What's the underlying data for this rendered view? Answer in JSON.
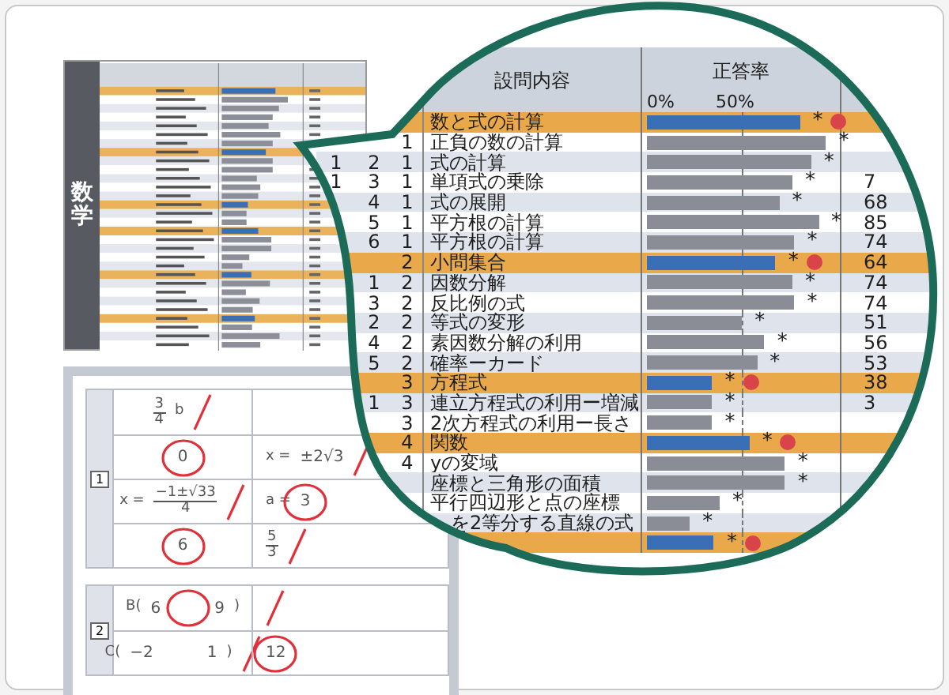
{
  "report": {
    "subject": "数学"
  },
  "answer_sheet": {
    "sections": [
      {
        "number": "1",
        "rows": [
          [
            {
              "fraction": {
                "num": "3",
                "den": "4"
              },
              "suffix": "b",
              "correct": false
            }
          ],
          [
            {
              "values": [
                "0"
              ],
              "correct": true
            },
            {
              "prefix": "x =",
              "values": [
                "±2√3"
              ],
              "correct": false
            }
          ],
          [
            {
              "prefix": "x =",
              "fraction": {
                "num": "−1±√33",
                "den": "4"
              },
              "correct": false
            },
            {
              "prefix": "a =",
              "values": [
                "3"
              ],
              "correct": true
            }
          ],
          [
            {
              "values": [
                "6"
              ],
              "correct": true
            },
            {
              "fraction": {
                "num": "5",
                "den": "3"
              },
              "correct": false
            }
          ]
        ]
      },
      {
        "number": "2",
        "rows": [
          [
            {
              "prefix": "B(",
              "values": [
                "6",
                "9"
              ],
              "suffix": ")",
              "correct": true
            },
            {
              "correct": false
            }
          ],
          [
            {
              "prefix": "C(",
              "values": [
                "−2",
                "1"
              ],
              "suffix": ")",
              "correct": false
            },
            {
              "values": [
                "12"
              ],
              "correct": true
            }
          ]
        ]
      }
    ]
  },
  "lens_table": {
    "header": {
      "content": "設問内容",
      "rate": "正答率",
      "tick_0": "0%",
      "tick_50": "50%"
    },
    "rows": [
      {
        "kind": "summary",
        "label": "数と式の計算",
        "level": 0.82,
        "mark": "*",
        "flag": true
      },
      {
        "kind": "item",
        "c3": "1",
        "label": "正負の数の計算",
        "level": 0.96,
        "mark": "*"
      },
      {
        "kind": "item",
        "c1": "1",
        "c2": "2",
        "c3": "1",
        "label": "式の計算",
        "level": 0.88,
        "mark": "*"
      },
      {
        "kind": "item",
        "c1": "1",
        "c2": "3",
        "c3": "1",
        "label": "単項式の乗除",
        "level": 0.78,
        "mark": "*",
        "value": "7"
      },
      {
        "kind": "item",
        "c2": "4",
        "c3": "1",
        "label": "式の展開",
        "level": 0.71,
        "mark": "*",
        "value": "68"
      },
      {
        "kind": "item",
        "c2": "5",
        "c3": "1",
        "label": "平方根の計算",
        "level": 0.92,
        "mark": "*",
        "value": "85"
      },
      {
        "kind": "item",
        "c2": "6",
        "c3": "1",
        "label": "平方根の計算",
        "level": 0.79,
        "mark": "*",
        "value": "74"
      },
      {
        "kind": "summary",
        "c3": "2",
        "label": "小問集合",
        "level": 0.69,
        "mark": "*",
        "flag": true,
        "value": "64"
      },
      {
        "kind": "item",
        "c2": "1",
        "c3": "2",
        "label": "因数分解",
        "level": 0.78,
        "mark": "*",
        "value": "74"
      },
      {
        "kind": "item",
        "c2": "3",
        "c3": "2",
        "label": "反比例の式",
        "level": 0.79,
        "mark": "*",
        "value": "74"
      },
      {
        "kind": "item",
        "c2": "2",
        "c3": "2",
        "label": "等式の変形",
        "level": 0.51,
        "mark": "*",
        "value": "51"
      },
      {
        "kind": "item",
        "c2": "4",
        "c3": "2",
        "label": "素因数分解の利用",
        "level": 0.63,
        "mark": "*",
        "value": "56"
      },
      {
        "kind": "item",
        "c2": "5",
        "c3": "2",
        "label": "確率ーカード",
        "level": 0.59,
        "mark": "*",
        "value": "53"
      },
      {
        "kind": "summary",
        "c3": "3",
        "label": "方程式",
        "level": 0.35,
        "mark": "*",
        "flag": true,
        "value": "38"
      },
      {
        "kind": "item",
        "c2": "1",
        "c3": "3",
        "label": "連立方程式の利用ー増減",
        "level": 0.35,
        "mark": "*",
        "value": "3"
      },
      {
        "kind": "item",
        "c3": "3",
        "label": "2次方程式の利用ー長さ",
        "level": 0.35,
        "mark": "*"
      },
      {
        "kind": "summary",
        "c3": "4",
        "label": "関数",
        "level": 0.55,
        "mark": "*",
        "flag": true
      },
      {
        "kind": "item",
        "c3": "4",
        "label": "yの変域",
        "level": 0.74,
        "mark": "*"
      },
      {
        "kind": "item",
        "label": "座標と三角形の面積",
        "level": 0.74,
        "mark": "*"
      },
      {
        "kind": "item",
        "label": "平行四辺形と点の座標",
        "level": 0.39,
        "mark": "*"
      },
      {
        "kind": "cut",
        "label": "を2等分する直線の式",
        "level": 0.23,
        "mark": "*"
      },
      {
        "kind": "summary",
        "level": 0.36,
        "mark": "*",
        "flag": true
      }
    ]
  }
}
